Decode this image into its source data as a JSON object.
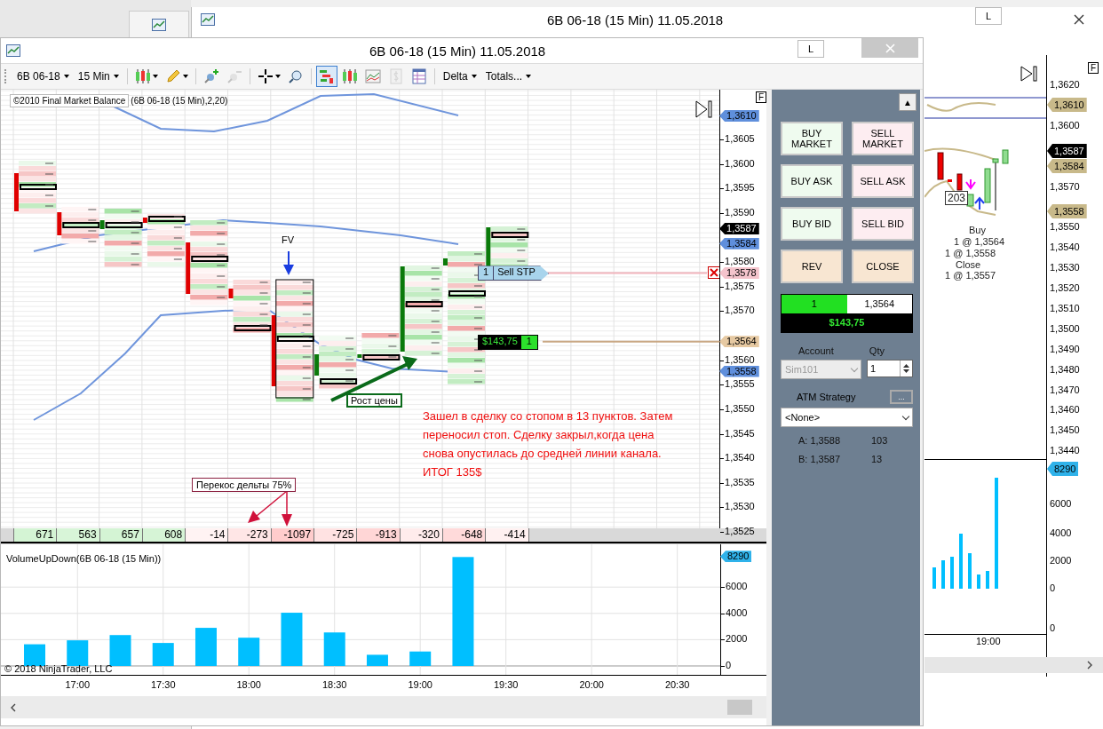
{
  "back_window": {
    "title": "6B 06-18 (15 Min)  11.05.2018",
    "layout_button": "L",
    "flag": "F",
    "price_axis": [
      "1,3620",
      "1,3600",
      "1,3570",
      "1,3550",
      "1,3540",
      "1,3530",
      "1,3520",
      "1,3510",
      "1,3500",
      "1,3490",
      "1,3480",
      "1,3470",
      "1,3460",
      "1,3450",
      "1,3440"
    ],
    "price_tags": [
      {
        "label": "1,3610",
        "color": "#c8b98a"
      },
      {
        "label": "1,3587",
        "color": "#000000"
      },
      {
        "label": "1,3584",
        "color": "#c8b98a"
      },
      {
        "label": "1,3558",
        "color": "#c8b98a"
      }
    ],
    "trade_labels": [
      {
        "kind": "count",
        "text": "203"
      },
      {
        "kind": "text",
        "text": "Buy"
      },
      {
        "kind": "text",
        "text": "1 @ 1,3564"
      },
      {
        "kind": "text",
        "text": "1 @ 1,3558"
      },
      {
        "kind": "text",
        "text": "Close"
      },
      {
        "kind": "text",
        "text": "1 @ 1,3557"
      }
    ],
    "volume_tag": "8290",
    "volume_axis": [
      "6000",
      "4000",
      "2000",
      "0",
      "0"
    ],
    "time_axis": [
      "19:00"
    ]
  },
  "window": {
    "title": "6B 06-18 (15 Min)  11.05.2018",
    "layout_button": "L"
  },
  "toolbar": {
    "instrument": "6B 06-18",
    "interval": "15 Min",
    "tool_buttons": [
      {
        "selected": false,
        "disabled": false,
        "dropdown": true
      },
      {
        "selected": false,
        "disabled": false,
        "dropdown": true
      },
      {
        "selected": false,
        "disabled": false,
        "dropdown": false
      },
      {
        "selected": false,
        "disabled": true,
        "dropdown": false
      },
      {
        "selected": false,
        "disabled": false,
        "dropdown": true
      },
      {
        "selected": false,
        "disabled": false,
        "dropdown": false
      },
      {
        "selected": true,
        "disabled": false,
        "dropdown": false
      },
      {
        "selected": false,
        "disabled": false,
        "dropdown": false
      },
      {
        "selected": false,
        "disabled": false,
        "dropdown": false
      },
      {
        "selected": false,
        "disabled": true,
        "dropdown": false
      },
      {
        "selected": false,
        "disabled": false,
        "dropdown": false
      }
    ],
    "delta": "Delta",
    "totals": "Totals..."
  },
  "price_panel": {
    "indicator_label": "©2010 Final Market Balance",
    "indicator_params": "(6B 06-18 (15 Min),2,20)",
    "flag": "F",
    "price_axis": [
      "1,3605",
      "1,3600",
      "1,3595",
      "1,3590",
      "1,3580",
      "1,3575",
      "1,3570",
      "1,3560",
      "1,3555",
      "1,3550",
      "1,3545",
      "1,3540",
      "1,3535",
      "1,3530",
      "1,3525"
    ],
    "price_tags": [
      {
        "label": "1,3610",
        "color": "#5f8fdc"
      },
      {
        "label": "1,3587",
        "color": "#000000"
      },
      {
        "label": "1,3584",
        "color": "#5f8fdc"
      },
      {
        "label": "1,3578",
        "color": "#f4c4cc"
      },
      {
        "label": "1,3564",
        "color": "#e6c9a2"
      },
      {
        "label": "1,3558",
        "color": "#5f8fdc"
      }
    ],
    "order": {
      "qty": "1",
      "label": "Sell STP"
    },
    "position": {
      "pnl": "$143,75",
      "qty": "1"
    },
    "notes": [
      {
        "kind": "arrow_down",
        "text": "FV"
      },
      {
        "kind": "boxed_arrow",
        "text": "Рост цены"
      },
      {
        "kind": "comment",
        "text": "Зашел в сделку со стопом в 13 пунктов. Затем\nпереносил стоп. Сделку закрыл,когда цена\nснова опустилась до средней линии канала.\nИТОГ 135$"
      },
      {
        "kind": "callout",
        "text": "Перекос дельты 75%"
      }
    ]
  },
  "delta_row": [
    {
      "value": "671",
      "color": "#d4f4d4"
    },
    {
      "value": "563",
      "color": "#d8f5d8"
    },
    {
      "value": "657",
      "color": "#d4f4d4"
    },
    {
      "value": "608",
      "color": "#d6f4d6"
    },
    {
      "value": "-14",
      "color": "#fff3f3"
    },
    {
      "value": "-273",
      "color": "#ffe6e6"
    },
    {
      "value": "-1097",
      "color": "#ffcccc"
    },
    {
      "value": "-725",
      "color": "#ffe2e2"
    },
    {
      "value": "-913",
      "color": "#ffd6d6"
    },
    {
      "value": "-320",
      "color": "#ffecec"
    },
    {
      "value": "-648",
      "color": "#ffdada"
    },
    {
      "value": "-414",
      "color": "#fff1f1"
    }
  ],
  "volume_panel": {
    "title": "VolumeUpDown(6B 06-18 (15 Min))",
    "copyright": "© 2018 NinjaTrader, LLC",
    "value_tag": "8290",
    "chart_data": {
      "type": "bar",
      "x": [
        16.75,
        17,
        17.25,
        17.5,
        17.75,
        18,
        18.25,
        18.5,
        18.75,
        19,
        19.25
      ],
      "values": [
        1650,
        1950,
        2350,
        1750,
        2900,
        2150,
        4050,
        2550,
        850,
        1100,
        8290
      ],
      "xlim": [
        16.553,
        21.02
      ],
      "ylim": [
        -676,
        9257
      ],
      "grid": true,
      "yticks": [
        {
          "value": 0,
          "label": "0"
        },
        {
          "value": 2000,
          "label": "2000"
        },
        {
          "value": 4000,
          "label": "4000"
        },
        {
          "value": 6000,
          "label": "6000"
        }
      ],
      "xticks": [
        {
          "value": 17,
          "label": "17:00"
        },
        {
          "value": 17.5,
          "label": "17:30"
        },
        {
          "value": 18,
          "label": "18:00"
        },
        {
          "value": 18.5,
          "label": "18:30"
        },
        {
          "value": 19,
          "label": "19:00"
        },
        {
          "value": 19.5,
          "label": "19:30"
        },
        {
          "value": 20,
          "label": "20:00"
        },
        {
          "value": 20.5,
          "label": "20:30"
        }
      ]
    }
  },
  "order_panel": {
    "collapse": "▲",
    "buttons": [
      {
        "label": "BUY MARKET",
        "kind": "buy"
      },
      {
        "label": "SELL MARKET",
        "kind": "sell"
      },
      {
        "label": "BUY ASK",
        "kind": "buy"
      },
      {
        "label": "SELL ASK",
        "kind": "sell"
      },
      {
        "label": "BUY BID",
        "kind": "buy"
      },
      {
        "label": "SELL BID",
        "kind": "sell"
      },
      {
        "label": "REV",
        "kind": "neutral"
      },
      {
        "label": "CLOSE",
        "kind": "neutral"
      }
    ],
    "position": {
      "qty": "1",
      "price": "1,3564",
      "pnl": "$143,75"
    },
    "account": {
      "label": "Account",
      "value": "Sim101",
      "disabled": true
    },
    "qty": {
      "label": "Qty",
      "value": "1"
    },
    "atm": {
      "label": "ATM Strategy",
      "button": "...",
      "value": "<None>"
    },
    "quotes": [
      {
        "price": "A: 1,3588",
        "size": "103"
      },
      {
        "price": "B: 1,3587",
        "size": "13"
      }
    ]
  }
}
